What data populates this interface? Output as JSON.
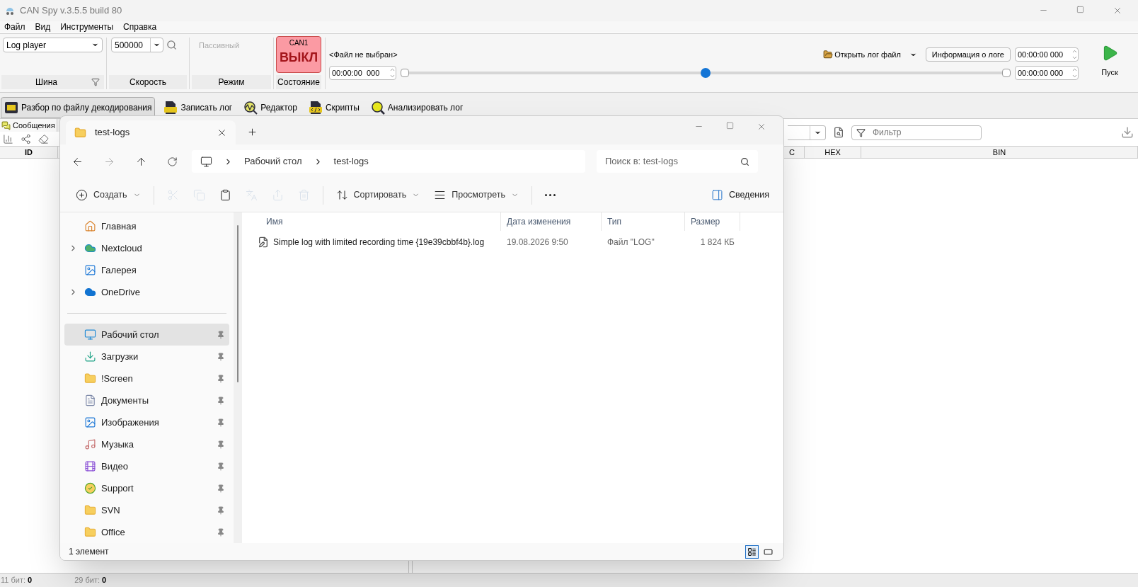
{
  "window": {
    "title": "CAN Spy v.3.5.5 build 80"
  },
  "menu": [
    "Файл",
    "Вид",
    "Инструменты",
    "Справка"
  ],
  "ribbon": {
    "bus": {
      "value": "Log player",
      "label": "Шина"
    },
    "speed": {
      "value": "500000",
      "label": "Скорость"
    },
    "mode": {
      "value": "Пассивный",
      "label": "Режим"
    },
    "state": {
      "channel": "CAN1",
      "value": "ВЫКЛ",
      "label": "Состояние",
      "on": false
    },
    "player": {
      "file": "<Файл не выбран>",
      "position": "00:00:00  000",
      "open_button": "Открыть лог файл",
      "info_button": "Информация о логе",
      "start_time": "00:00:00 000",
      "end_time": "00:00:00 000",
      "level": 0.5,
      "play_label": "Пуск"
    }
  },
  "tools": [
    {
      "label": "Разбор по файлу декодирования",
      "kind": "decode",
      "selected": true
    },
    {
      "label": "Записать лог",
      "kind": "log",
      "selected": false
    },
    {
      "label": "Редактор",
      "kind": "editor",
      "selected": false
    },
    {
      "label": "Скрипты",
      "kind": "script",
      "selected": false
    },
    {
      "label": "Анализировать лог",
      "kind": "analyze",
      "selected": false
    }
  ],
  "messages_panel": {
    "tab": "Сообщения",
    "columns": [
      "ID"
    ]
  },
  "data_panel": {
    "filter_placeholder": "Фильтр",
    "columns": [
      "C",
      "HEX",
      "BIN"
    ]
  },
  "status_bar": [
    {
      "label": "11 бит:",
      "value": "0"
    },
    {
      "label": "29 бит:",
      "value": "0"
    }
  ],
  "explorer": {
    "tab": "test-logs",
    "breadcrumb": [
      "Рабочий стол",
      "test-logs"
    ],
    "search_placeholder": "Поиск в: test-logs",
    "commands": [
      {
        "kind": "new",
        "label": "Создать",
        "disabled": false
      },
      {
        "kind": "cut",
        "disabled": true
      },
      {
        "kind": "copy",
        "disabled": true
      },
      {
        "kind": "paste",
        "disabled": false
      },
      {
        "kind": "rename",
        "disabled": true
      },
      {
        "kind": "share",
        "disabled": true
      },
      {
        "kind": "delete",
        "disabled": true
      },
      {
        "kind": "sort",
        "label": "Сортировать",
        "disabled": false
      },
      {
        "kind": "view",
        "label": "Просмотреть",
        "disabled": false
      },
      {
        "kind": "more",
        "disabled": false
      }
    ],
    "details_button": "Сведения",
    "sidebar": [
      {
        "label": "Главная",
        "kind": "home",
        "expandable": false,
        "pinned": false,
        "selected": false
      },
      {
        "label": "Nextcloud",
        "kind": "nextcloud",
        "expandable": true,
        "pinned": false,
        "selected": false
      },
      {
        "label": "Галерея",
        "kind": "gallery",
        "expandable": false,
        "pinned": false,
        "selected": false
      },
      {
        "label": "OneDrive",
        "kind": "onedrive",
        "expandable": true,
        "pinned": false,
        "selected": false
      },
      {
        "kind": "separator"
      },
      {
        "label": "Рабочий стол",
        "kind": "desktop",
        "expandable": false,
        "pinned": true,
        "selected": true
      },
      {
        "label": "Загрузки",
        "kind": "downloads",
        "expandable": false,
        "pinned": true,
        "selected": false
      },
      {
        "label": "!Screen",
        "kind": "folder",
        "expandable": false,
        "pinned": true,
        "selected": false
      },
      {
        "label": "Документы",
        "kind": "documents",
        "expandable": false,
        "pinned": true,
        "selected": false
      },
      {
        "label": "Изображения",
        "kind": "pictures",
        "expandable": false,
        "pinned": true,
        "selected": false
      },
      {
        "label": "Музыка",
        "kind": "music",
        "expandable": false,
        "pinned": true,
        "selected": false
      },
      {
        "label": "Видео",
        "kind": "video",
        "expandable": false,
        "pinned": true,
        "selected": false
      },
      {
        "label": "Support",
        "kind": "synced-folder",
        "expandable": false,
        "pinned": true,
        "selected": false
      },
      {
        "label": "SVN",
        "kind": "folder",
        "expandable": false,
        "pinned": true,
        "selected": false
      },
      {
        "label": "Office",
        "kind": "folder",
        "expandable": false,
        "pinned": true,
        "selected": false
      }
    ],
    "columns": [
      "Имя",
      "Дата изменения",
      "Тип",
      "Размер"
    ],
    "files": [
      {
        "name": "Simple log with limited recording time {19e39cbbf4b}.log",
        "date": "19.08.2026 9:50",
        "type": "Файл \"LOG\"",
        "size": "1 824 КБ"
      }
    ],
    "status": "1 элемент",
    "view_buttons": [
      {
        "kind": "details",
        "selected": true
      },
      {
        "kind": "tiles",
        "selected": false
      }
    ]
  }
}
